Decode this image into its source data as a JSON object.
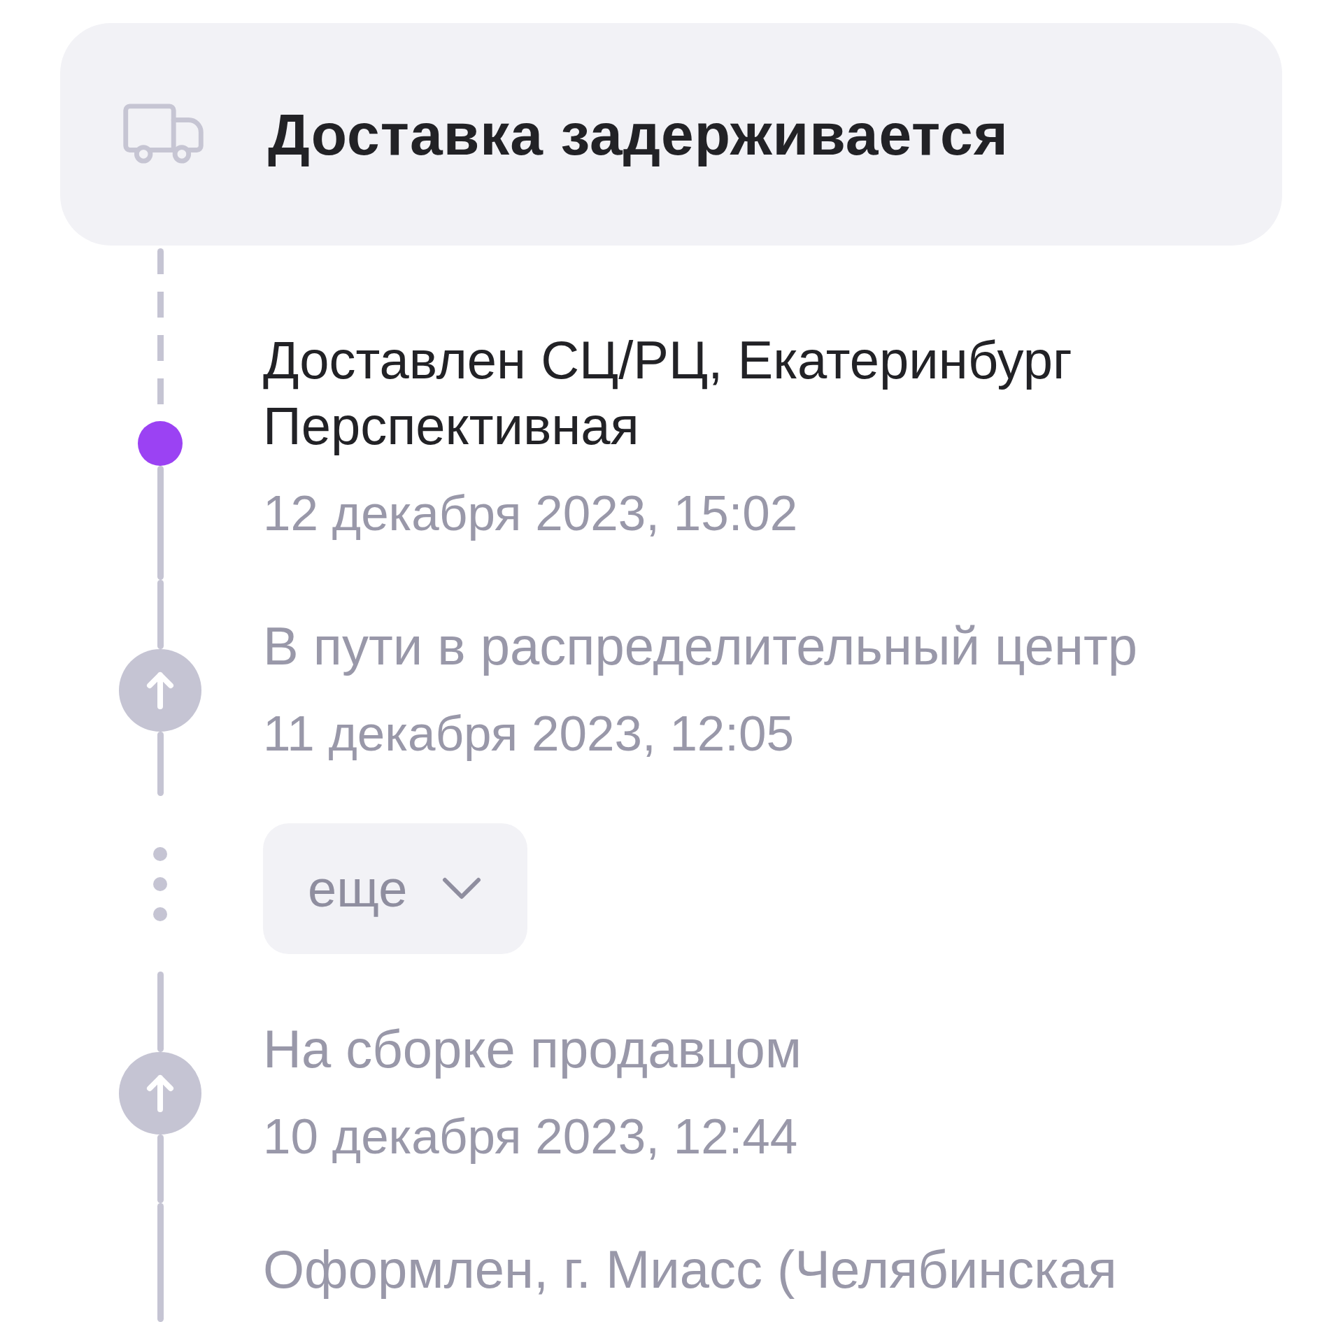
{
  "status_card": {
    "title": "Доставка задерживается"
  },
  "timeline": {
    "items": [
      {
        "kind": "event",
        "title": "Доставлен СЦ/РЦ, Екатеринбург Перспективная",
        "date": "12 декабря 2023, 15:02",
        "current": true,
        "marker": {
          "kind": "dot"
        }
      },
      {
        "kind": "event",
        "title": "В пути в распределительный центр",
        "date": "11 декабря 2023, 12:05",
        "current": false,
        "marker": {
          "kind": "arrow"
        }
      },
      {
        "kind": "more",
        "label": "еще",
        "expanded": false
      },
      {
        "kind": "event",
        "title": "На сборке продавцом",
        "date": "10 декабря 2023, 12:44",
        "current": false,
        "marker": {
          "kind": "arrow"
        }
      },
      {
        "kind": "event",
        "title": "Оформлен, г. Миасс (Челябинская",
        "current": false
      }
    ]
  }
}
